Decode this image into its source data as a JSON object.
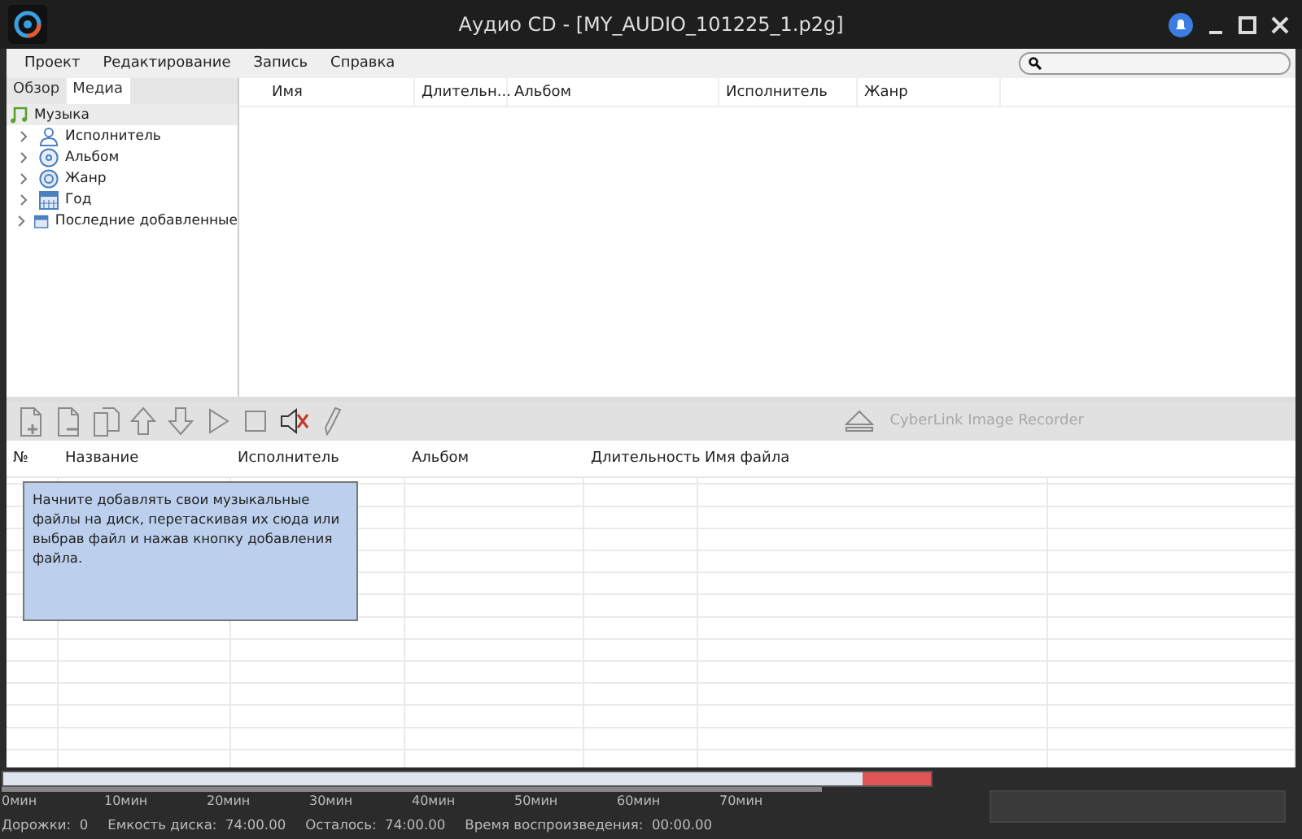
{
  "window": {
    "title": "Аудио CD - [MY_AUDIO_101225_1.p2g]"
  },
  "menu": [
    "Проект",
    "Редактирование",
    "Запись",
    "Справка"
  ],
  "left_tabs": [
    {
      "label": "Обзор",
      "selected": false
    },
    {
      "label": "Медиа",
      "selected": true
    }
  ],
  "tree": {
    "label": "Музыка",
    "selected": true,
    "children": [
      {
        "label": "Исполнитель",
        "kind": "artist",
        "expanded": false
      },
      {
        "label": "Альбом",
        "kind": "album",
        "expanded": false
      },
      {
        "label": "Жанр",
        "kind": "genre",
        "expanded": false
      },
      {
        "label": "Год",
        "kind": "year",
        "expanded": false
      },
      {
        "label": "Последние добавленные",
        "kind": "recent",
        "expanded": false
      }
    ]
  },
  "media_table": {
    "columns": [
      "Имя",
      "Длительн...",
      "Альбом",
      "Исполнитель",
      "Жанр"
    ]
  },
  "toolbar": {
    "buttons": [
      {
        "kind": "add"
      },
      {
        "kind": "add2"
      },
      {
        "kind": "copy"
      },
      {
        "kind": "up"
      },
      {
        "kind": "down"
      },
      {
        "kind": "play"
      },
      {
        "kind": "stop"
      },
      {
        "kind": "mute"
      },
      {
        "kind": "pen"
      }
    ],
    "recorder": "CyberLink Image Recorder"
  },
  "track_table": {
    "columns": [
      "№",
      "Название",
      "Исполнитель",
      "Альбом",
      "Длительность",
      "Имя файла"
    ]
  },
  "hint": "Начните добавлять свои музыкальные файлы на диск, перетаскивая их сюда или выбрав файл и нажав кнопку добавления файла.",
  "capacity": {
    "ticks": [
      "0мин",
      "10мин",
      "20мин",
      "30мин",
      "40мин",
      "50мин",
      "60мин",
      "70мин"
    ]
  },
  "status": [
    {
      "label": "Дорожки:",
      "value": "0"
    },
    {
      "label": "Емкость диска:",
      "value": "74:00.00"
    },
    {
      "label": "Осталось:",
      "value": "74:00.00"
    },
    {
      "label": "Время воспроизведения:",
      "value": "00:00.00"
    }
  ]
}
